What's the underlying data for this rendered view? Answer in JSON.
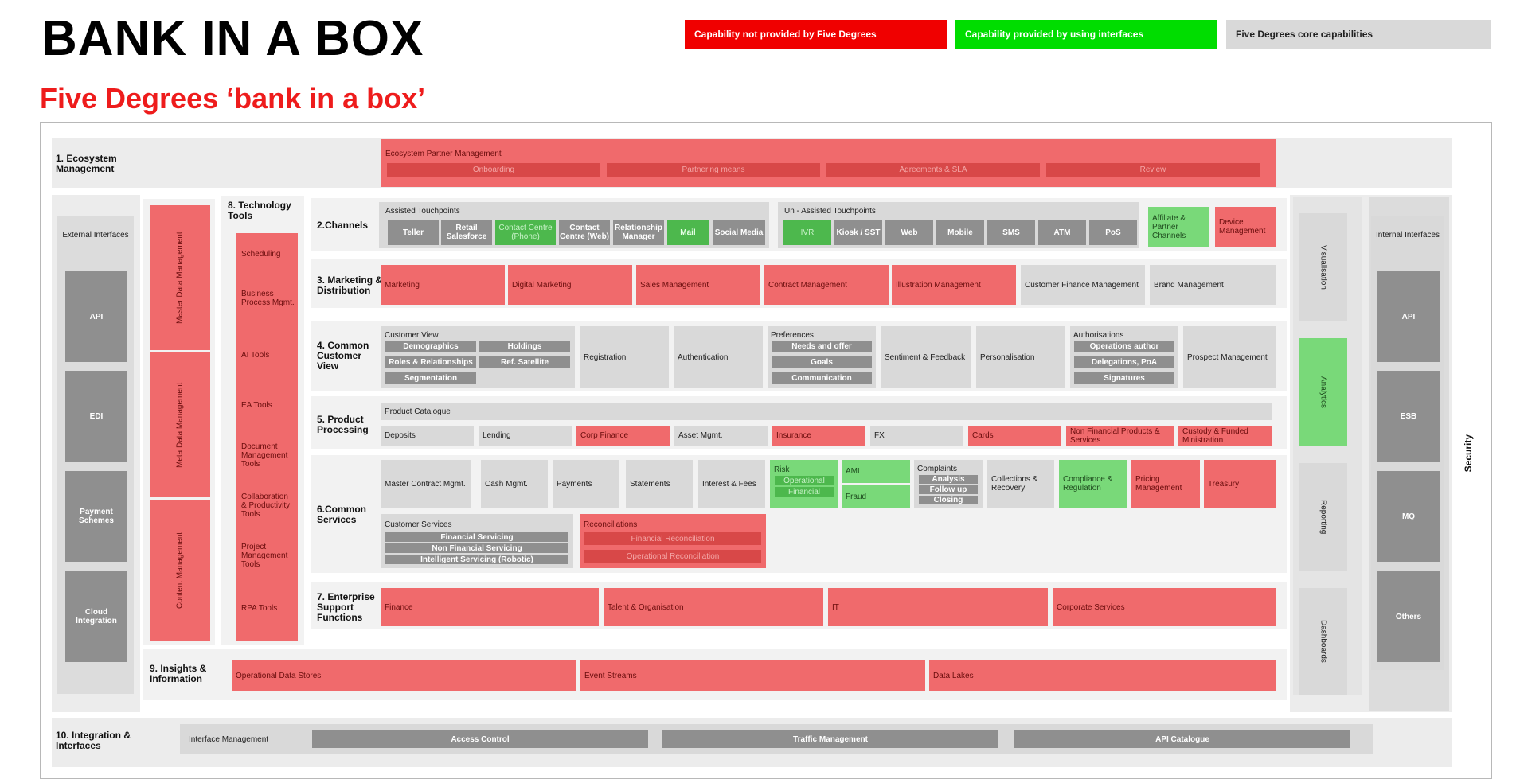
{
  "header": {
    "title": "BANK IN A BOX",
    "subtitle": "Five Degrees ‘bank in a box’"
  },
  "legend": {
    "not_provided": "Capability not provided by Five Degrees",
    "interfaces": "Capability provided by using interfaces",
    "core": "Five Degrees core capabilities"
  },
  "colors": {
    "not_provided": "#f00000",
    "interfaces": "#00dd00",
    "core": "#d9d9d9",
    "light_red": "#f06a6c",
    "light_green": "#79d979"
  },
  "ecosystem": {
    "title": "1. Ecosystem Management",
    "partner": "Ecosystem Partner Management",
    "items": [
      "Onboarding",
      "Partnering means",
      "Agreements & SLA",
      "Review"
    ]
  },
  "left": {
    "title": "External Interfaces",
    "items": [
      "API",
      "EDI",
      "Payment Schemes",
      "Cloud Integration"
    ]
  },
  "data_mgmt": [
    "Master Data Management",
    "Meta Data Management",
    "Content Management"
  ],
  "tech_tools": {
    "title": "8. Technology Tools",
    "items": [
      "Scheduling",
      "Business Process Mgmt.",
      "AI Tools",
      "EA Tools",
      "Document Management Tools",
      "Collaboration & Productivity Tools",
      "Project Management Tools",
      "RPA Tools"
    ]
  },
  "channels": {
    "title": "2.Channels",
    "assisted": "Assisted Touchpoints",
    "assisted_items": [
      "Teller",
      "Retail Salesforce",
      "Contact Centre (Phone)",
      "Contact Centre (Web)",
      "Relationship Manager",
      "Mail",
      "Social Media"
    ],
    "unassisted": "Un - Assisted Touchpoints",
    "unassisted_items": [
      "IVR",
      "Kiosk / SST",
      "Web",
      "Mobile",
      "SMS",
      "ATM",
      "PoS"
    ],
    "affiliate": "Affiliate & Partner Channels",
    "device": "Device Management"
  },
  "marketing": {
    "title": "3. Marketing & Distribution",
    "items": [
      "Marketing",
      "Digital Marketing",
      "Sales Management",
      "Contract Management",
      "Illustration Management",
      "Customer Finance Management",
      "Brand Management"
    ]
  },
  "customer": {
    "title": "4. Common Customer View",
    "view": "Customer View",
    "view_items": [
      "Demographics",
      "Holdings",
      "Roles & Relationships",
      "Ref. Satellite",
      "Segmentation"
    ],
    "registration": "Registration",
    "authentication": "Authentication",
    "preferences": "Preferences",
    "pref_items": [
      "Needs and offer",
      "Goals",
      "Communication"
    ],
    "sentiment": "Sentiment & Feedback",
    "personalisation": "Personalisation",
    "authorisations": "Authorisations",
    "auth_items": [
      "Operations author",
      "Delegations, PoA",
      "Signatures"
    ],
    "prospect": "Prospect Management"
  },
  "product": {
    "title": "5. Product Processing",
    "catalogue": "Product Catalogue",
    "items": [
      "Deposits",
      "Lending",
      "Corp Finance",
      "Asset Mgmt.",
      "Insurance",
      "FX",
      "Cards",
      "Non Financial Products & Services",
      "Custody & Funded Ministration"
    ]
  },
  "services": {
    "title": "6.Common Services",
    "row1": [
      "Master Contract Mgmt.",
      "Cash Mgmt.",
      "Payments",
      "Statements",
      "Interest & Fees"
    ],
    "risk": "Risk",
    "risk_items": [
      "Operational",
      "Financial"
    ],
    "aml": "AML",
    "fraud": "Fraud",
    "complaints": "Complaints",
    "complaint_items": [
      "Analysis",
      "Follow up",
      "Closing"
    ],
    "collections": "Collections & Recovery",
    "compliance": "Compliance & Regulation",
    "pricing": "Pricing Management",
    "treasury": "Treasury",
    "cust_services": "Customer Services",
    "cust_items": [
      "Financial Servicing",
      "Non Financial Servicing",
      "Intelligent Servicing (Robotic)"
    ],
    "reconciliations": "Reconciliations",
    "recon_items": [
      "Financial Reconciliation",
      "Operational Reconciliation"
    ]
  },
  "enterprise": {
    "title": "7. Enterprise Support Functions",
    "items": [
      "Finance",
      "Talent & Organisation",
      "IT",
      "Corporate Services"
    ]
  },
  "insights": {
    "title": "9. Insights & Information",
    "items": [
      "Operational Data Stores",
      "Event Streams",
      "Data Lakes"
    ]
  },
  "right_col": [
    "Visualisation",
    "Analytics",
    "Reporting",
    "Dashboards"
  ],
  "internal": {
    "title": "Internal Interfaces",
    "items": [
      "API",
      "ESB",
      "MQ",
      "Others"
    ]
  },
  "security": "Security",
  "integration": {
    "title": "10. Integration & Interfaces",
    "label": "Interface Management",
    "items": [
      "Access Control",
      "Traffic Management",
      "API Catalogue"
    ]
  }
}
